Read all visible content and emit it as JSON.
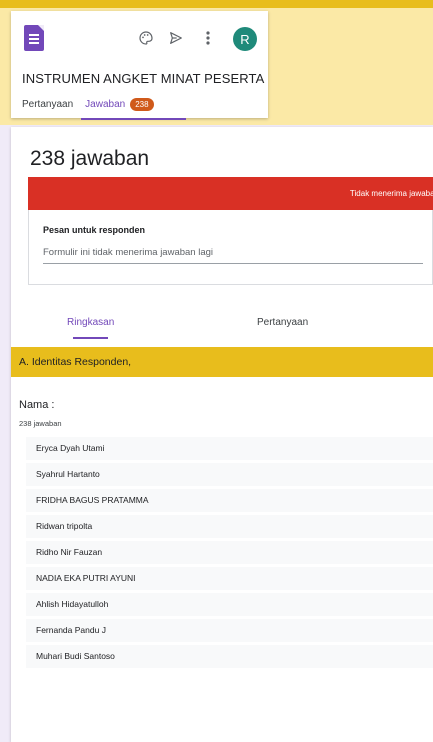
{
  "form": {
    "title": "INSTRUMEN ANGKET MINAT PESERTA",
    "avatar_initial": "R",
    "tabs": [
      {
        "label": "Pertanyaan"
      },
      {
        "label": "Jawaban",
        "badge": "238"
      }
    ],
    "icons": {
      "logo": "forms-logo-icon",
      "palette": "palette-icon",
      "send": "send-icon",
      "more": "more-vert-icon"
    }
  },
  "responses": {
    "count_label": "238 jawaban",
    "banner_text": "Tidak menerima jawaban",
    "message_label": "Pesan untuk responden",
    "message_value": "Formulir ini tidak menerima jawaban lagi",
    "sub_tabs": [
      {
        "label": "Ringkasan"
      },
      {
        "label": "Pertanyaan"
      }
    ],
    "section_title": "A. Identitas Responden,",
    "question": {
      "title": "Nama :",
      "count": "238 jawaban",
      "answers": [
        "Eryca Dyah Utami",
        "Syahrul Hartanto",
        "FRIDHA BAGUS PRATAMMA",
        "Ridwan tripolta",
        "Ridho Nir Fauzan",
        "NADIA EKA PUTRI AYUNI",
        "Ahlish Hidayatulloh",
        "Fernanda Pandu J",
        "Muhari Budi Santoso"
      ]
    }
  },
  "colors": {
    "accent": "#7248b9",
    "banner_red": "#d93025",
    "section_yellow": "#e8bd1c",
    "badge": "#d05a1b",
    "avatar": "#1f8a7a"
  }
}
